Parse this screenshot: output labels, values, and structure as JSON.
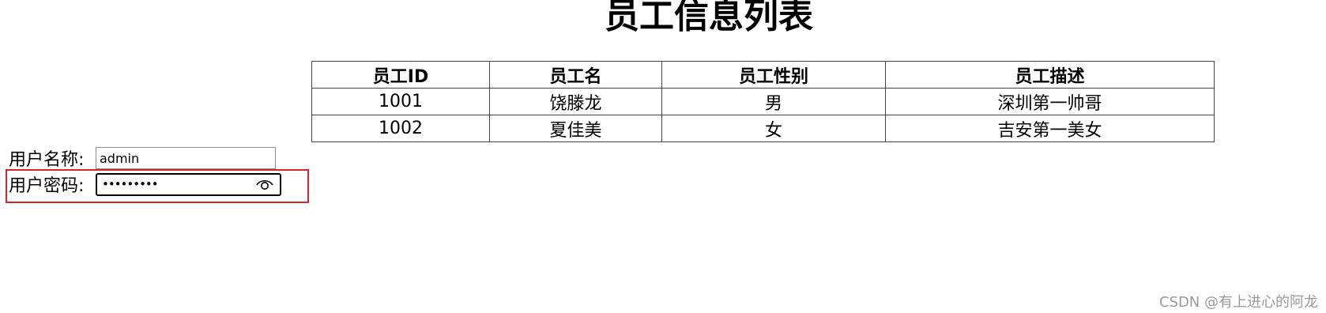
{
  "page": {
    "title": "员工信息列表"
  },
  "employee_table": {
    "headers": [
      "员工ID",
      "员工名",
      "员工性别",
      "员工描述"
    ],
    "rows": [
      [
        "1001",
        "饶滕龙",
        "男",
        "深圳第一帅哥"
      ],
      [
        "1002",
        "夏佳美",
        "女",
        "吉安第一美女"
      ]
    ]
  },
  "login_form": {
    "username_label": "用户名称:",
    "username_value": "admin",
    "password_label": "用户密码:",
    "password_masked": "•••••••••",
    "reveal_icon": "eye-icon"
  },
  "annotation": {
    "highlight_color": "#d9232a"
  },
  "watermark": "CSDN @有上进心的阿龙"
}
